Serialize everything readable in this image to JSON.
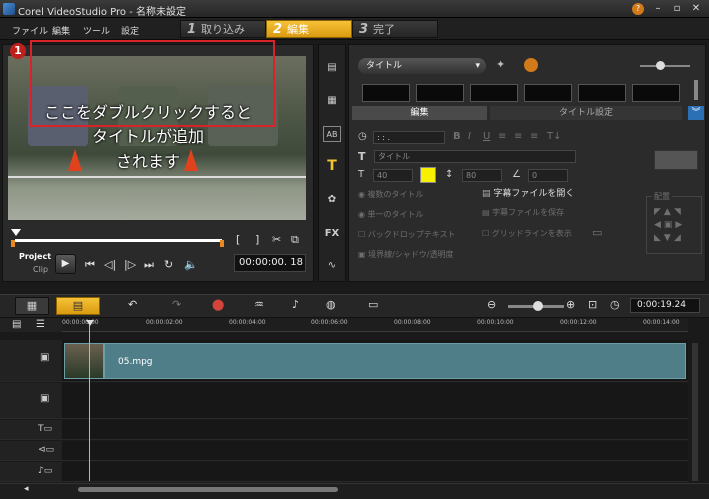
{
  "window": {
    "title": "Corel VideoStudio Pro - 名称未設定",
    "minimize": "–",
    "maximize": "▫",
    "close": "✕",
    "help": "?"
  },
  "menu": [
    "ファイル",
    "編集",
    "ツール",
    "設定"
  ],
  "steps": [
    {
      "num": "1",
      "label": "取り込み",
      "active": false
    },
    {
      "num": "2",
      "label": "編集",
      "active": true
    },
    {
      "num": "3",
      "label": "完了",
      "active": false
    }
  ],
  "preview": {
    "badge": "1",
    "overlay_line1": "ここをダブルクリックすると",
    "overlay_line2": "タイトルが追加",
    "overlay_line3": "されます",
    "mode_project": "Project",
    "mode_clip": "Clip",
    "mark_in": "[",
    "mark_out": "]",
    "timecode": "00:00:00. 18"
  },
  "library": {
    "dropdown": "タイトル",
    "tab_edit": "編集",
    "tab_title_settings": "タイトル設定",
    "time_field": " :  :  . ",
    "font_field": "タイトル",
    "size_value": "40",
    "line_spacing": "80",
    "angle": "0",
    "opt_multi": "複数のタイトル",
    "opt_single": "単一のタイトル",
    "opt_backdrop": "バックドロップテキスト",
    "opt_border": "境界線/シャドウ/透明度",
    "btn_open_subtitle": "字幕ファイルを開く",
    "btn_save_subtitle": "字幕ファイルを保存",
    "btn_gridlines": "グリッドラインを表示",
    "align_label": "配置",
    "text_color": "#f7f000"
  },
  "timeline": {
    "ticks": [
      "00:00:00:00",
      "00:00:02:00",
      "00:00:04:00",
      "00:00:06:00",
      "00:00:08:00",
      "00:00:10:00",
      "00:00:12:00",
      "00:00:14:00"
    ],
    "clip_name": "05.mpg",
    "time": "0:00:19.24"
  }
}
